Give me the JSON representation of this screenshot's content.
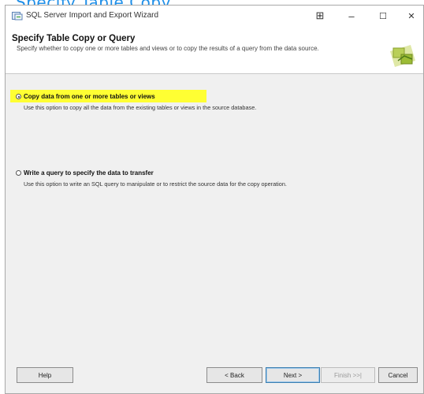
{
  "overlay_heading": "Specify Table Copy",
  "window": {
    "title": "SQL Server Import and Export Wizard",
    "controls": {
      "restore_glyph": "⊞",
      "minimize_glyph": "–",
      "maximize_glyph": "☐",
      "close_glyph": "✕"
    }
  },
  "header": {
    "title": "Specify Table Copy or Query",
    "description": "Specify whether to copy one or more tables and views or to copy the results of a query from the data source."
  },
  "options": [
    {
      "label": "Copy data from one or more tables or views",
      "description": "Use this option to copy all the data from the existing tables or views in the source database.",
      "selected": true,
      "highlight_color": "#ffff33"
    },
    {
      "label": "Write a query to specify the data to transfer",
      "description": "Use this option to write an SQL query to manipulate or to restrict the source data for the copy operation.",
      "selected": false
    }
  ],
  "footer": {
    "help_label": "Help",
    "back_label": "< Back",
    "next_label": "Next >",
    "finish_label": "Finish >>|",
    "cancel_label": "Cancel"
  }
}
